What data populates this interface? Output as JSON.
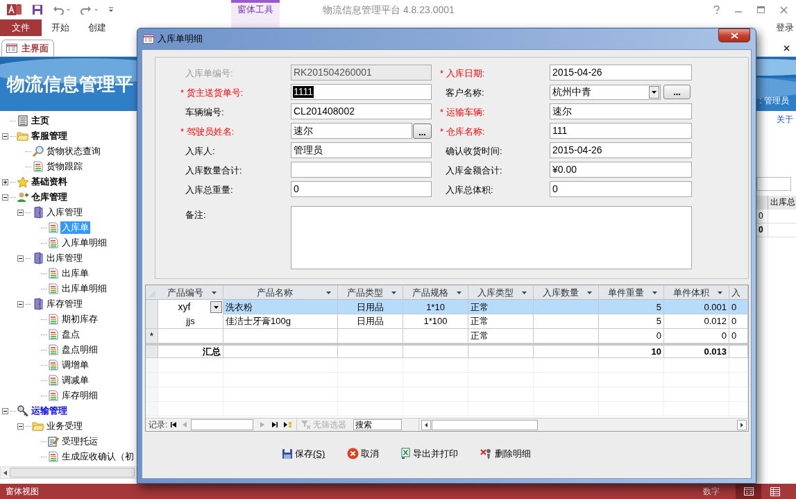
{
  "app": {
    "title": "物流信息管理平台 4.8.23.0001",
    "context_group": "窗体工具",
    "login": "登录"
  },
  "ribbon_tabs": [
    {
      "label": "文件",
      "kind": "file",
      "selected": false
    },
    {
      "label": "开始",
      "kind": "normal",
      "selected": false
    },
    {
      "label": "创建",
      "kind": "normal",
      "selected": false
    }
  ],
  "document_tab": {
    "label": "主界面"
  },
  "banner": {
    "title": "物流信息管理平",
    "user": ": 管理员"
  },
  "about_link": "关于",
  "tree": [
    {
      "label": "主页",
      "kind": "list",
      "color": "#000000",
      "selected": false
    },
    {
      "label": "客服管理",
      "kind": "folder",
      "color": "#000000",
      "selected": false,
      "expanded": true,
      "children": [
        {
          "label": "货物状态查询",
          "kind": "search",
          "selected": false
        },
        {
          "label": "货物跟踪",
          "kind": "page",
          "selected": false
        }
      ]
    },
    {
      "label": "基础资料",
      "kind": "star",
      "color": "#000000",
      "selected": false,
      "expanded": false
    },
    {
      "label": "仓库管理",
      "kind": "user",
      "color": "#000000",
      "selected": false,
      "expanded": true,
      "children": [
        {
          "label": "入库管理",
          "kind": "door",
          "selected": false,
          "expanded": true,
          "children": [
            {
              "label": "入库单",
              "kind": "page",
              "selected": true
            },
            {
              "label": "入库单明细",
              "kind": "page",
              "selected": false
            }
          ]
        },
        {
          "label": "出库管理",
          "kind": "door",
          "selected": false,
          "expanded": true,
          "children": [
            {
              "label": "出库单",
              "kind": "page",
              "selected": false
            },
            {
              "label": "出库单明细",
              "kind": "page",
              "selected": false
            }
          ]
        },
        {
          "label": "库存管理",
          "kind": "door",
          "selected": false,
          "expanded": true,
          "children": [
            {
              "label": "期初库存",
              "kind": "page",
              "selected": false
            },
            {
              "label": "盘点",
              "kind": "page",
              "selected": false
            },
            {
              "label": "盘点明细",
              "kind": "page",
              "selected": false
            },
            {
              "label": "调增单",
              "kind": "page",
              "selected": false
            },
            {
              "label": "调减单",
              "kind": "page",
              "selected": false
            },
            {
              "label": "库存明细",
              "kind": "page",
              "selected": false
            }
          ]
        }
      ]
    },
    {
      "label": "运输管理",
      "kind": "key",
      "color": "#0000ff",
      "selected": false,
      "expanded": true,
      "children": [
        {
          "label": "业务受理",
          "kind": "folder",
          "selected": false,
          "expanded": true,
          "children": [
            {
              "label": "受理托运",
              "kind": "edit",
              "selected": false
            },
            {
              "label": "生成应收确认（初",
              "kind": "page",
              "selected": false
            }
          ]
        }
      ]
    }
  ],
  "background_grid": {
    "header": "出库总",
    "cells": [
      {
        "text": "0",
        "bold": false
      },
      {
        "text": "0",
        "bold": true
      }
    ]
  },
  "status_bar": {
    "mode": "窗体视图",
    "indicator": "数字"
  },
  "dialog": {
    "title": "入库单明细",
    "form": {
      "rows": [
        {
          "left": {
            "label": "入库单编号:",
            "value": "RK201504260001",
            "kind": "readonly",
            "required": false
          },
          "right": {
            "label": "* 入库日期:",
            "value": "2015-04-26",
            "kind": "text",
            "required": true
          }
        },
        {
          "left": {
            "label": "* 货主送货单号:",
            "value": "1111",
            "kind": "text",
            "required": true,
            "text_selected": true
          },
          "right": {
            "label": "客户名称:",
            "value": "杭州中青",
            "kind": "combo",
            "required": false
          }
        },
        {
          "left": {
            "label": "车辆编号:",
            "value": "CL201408002",
            "kind": "text",
            "required": false
          },
          "right": {
            "label": "* 运输车辆:",
            "value": "速尔",
            "kind": "text",
            "required": true
          }
        },
        {
          "left": {
            "label": "* 驾驶员姓名:",
            "value": "速尔",
            "kind": "lookup",
            "required": true
          },
          "right": {
            "label": "* 仓库名称:",
            "value": "111",
            "kind": "text",
            "required": true
          }
        },
        {
          "left": {
            "label": "入库人:",
            "value": "管理员",
            "kind": "text",
            "required": false
          },
          "right": {
            "label": "确认收货时间:",
            "value": "2015-04-26",
            "kind": "text",
            "required": false
          }
        },
        {
          "left": {
            "label": "入库数量合计:",
            "kind": "text",
            "required": false
          },
          "right": {
            "label": "入库金额合计:",
            "value": "¥0.00",
            "kind": "text",
            "required": false
          }
        },
        {
          "left": {
            "label": "入库总重量:",
            "value": "0",
            "kind": "text",
            "required": false
          },
          "right": {
            "label": "入库总体积:",
            "value": "0",
            "kind": "text",
            "required": false
          }
        }
      ],
      "remarks": {
        "label": "备注:"
      }
    },
    "grid": {
      "columns": [
        "产品编号",
        "产品名称",
        "产品类型",
        "产品规格",
        "入库类型",
        "入库数量",
        "单件重量",
        "单件体积",
        "入"
      ],
      "rows": [
        {
          "kind": "data",
          "selected": true,
          "cells": [
            "xyf",
            "洗衣粉",
            "日用品",
            "1*10",
            "正常",
            null,
            "5",
            "0.001",
            "0"
          ]
        },
        {
          "kind": "data",
          "selected": false,
          "cells": [
            "jjs",
            "佳洁士牙膏100g",
            "日用品",
            "1*100",
            "正常",
            null,
            "5",
            "0.012",
            "0"
          ]
        },
        {
          "kind": "new",
          "selected": false,
          "marker": "*",
          "cells": [
            null,
            null,
            null,
            null,
            "正常",
            null,
            "0",
            "0",
            "0"
          ]
        },
        {
          "kind": "total",
          "selected": false,
          "cells": [
            "汇总",
            null,
            null,
            null,
            null,
            null,
            "10",
            "0.013",
            null
          ]
        }
      ],
      "navigator": {
        "label": "记录:",
        "filter": "无筛选器",
        "search_placeholder": "搜索"
      }
    },
    "buttons": [
      {
        "label": "保存",
        "shortcut": "(S)",
        "kind": "save"
      },
      {
        "label": "取消",
        "kind": "cancel"
      },
      {
        "label": "导出并打印",
        "kind": "export"
      },
      {
        "label": "删除明细",
        "kind": "delete"
      }
    ]
  }
}
